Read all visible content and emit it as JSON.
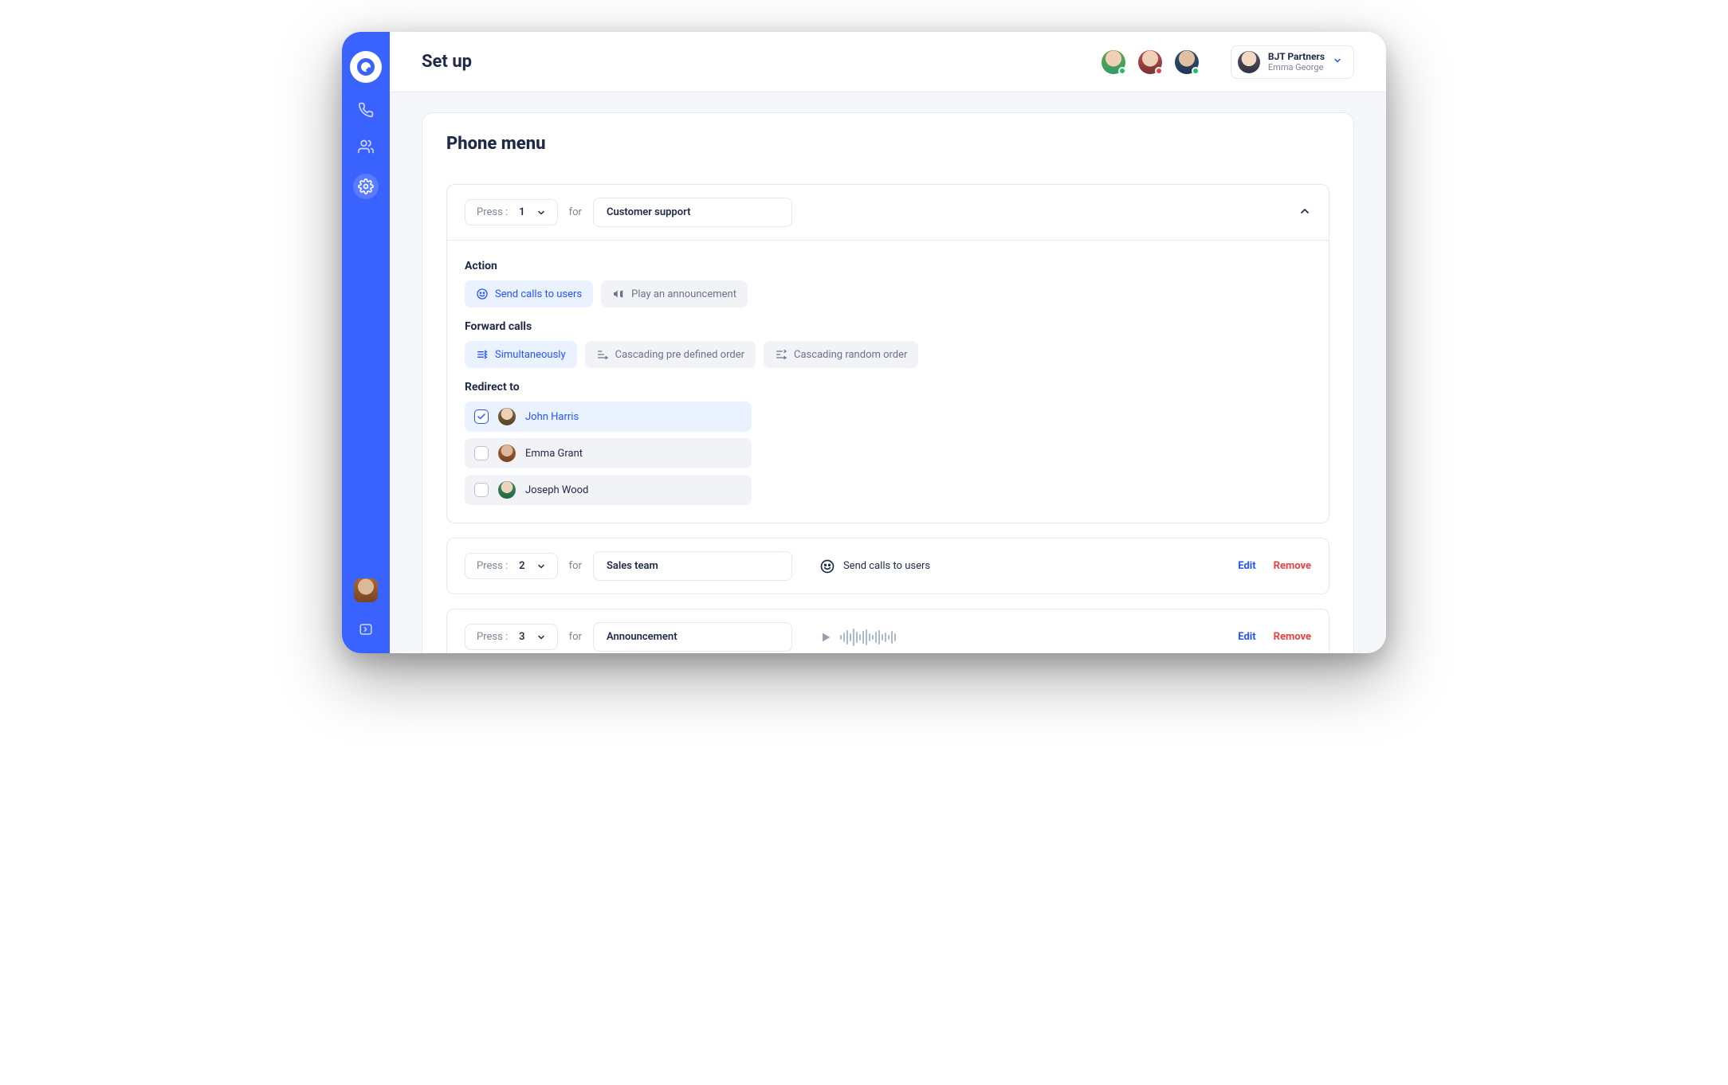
{
  "header": {
    "title": "Set up",
    "account": {
      "org": "BJT Partners",
      "user": "Emma George"
    },
    "presence": [
      {
        "name": "user-1",
        "status": "online"
      },
      {
        "name": "user-2",
        "status": "busy"
      },
      {
        "name": "user-3",
        "status": "online"
      }
    ]
  },
  "page": {
    "title": "Phone menu",
    "press_label": "Press :",
    "for_label": "for",
    "actions": {
      "edit": "Edit",
      "remove": "Remove"
    }
  },
  "option1": {
    "number": "1",
    "name": "Customer support",
    "section_action_label": "Action",
    "action_send_calls": "Send calls to users",
    "action_play_announcement": "Play an announcement",
    "section_forward_label": "Forward calls",
    "forward_simultaneous": "Simultaneously",
    "forward_cascade_defined": "Cascading pre defined order",
    "forward_cascade_random": "Cascading random order",
    "section_redirect_label": "Redirect to",
    "users": {
      "u1": {
        "name": "John Harris",
        "selected": true
      },
      "u2": {
        "name": "Emma Grant",
        "selected": false
      },
      "u3": {
        "name": "Joseph Wood",
        "selected": false
      }
    }
  },
  "option2": {
    "number": "2",
    "name": "Sales team",
    "summary": "Send calls to users"
  },
  "option3": {
    "number": "3",
    "name": "Announcement"
  },
  "icons": {
    "phone": "phone-icon",
    "users": "users-icon",
    "settings": "gear-icon",
    "expand_sidebar": "expand-sidebar-icon"
  }
}
